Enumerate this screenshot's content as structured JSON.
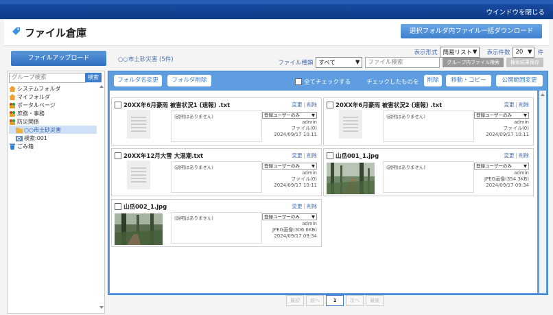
{
  "window": {
    "close_label": "ウインドウを閉じる"
  },
  "header": {
    "title": "ファイル倉庫",
    "download_label": "選択フォルダ内ファイル一括ダウンロード"
  },
  "upload_label": "ファイルアップロード",
  "current_folder": "○○市土砂災害 (5件)",
  "controls": {
    "display_format_label": "表示形式",
    "display_format_value": "簡易リスト",
    "count_label": "表示件数",
    "count_value": "20",
    "count_unit": "件",
    "file_type_label": "ファイル種類",
    "file_type_value": "すべて",
    "search_placeholder": "ファイル検索",
    "group_search_btn": "グループ内ファイル検索",
    "save_search_btn": "検索結果保存"
  },
  "sidebar": {
    "search_placeholder": "グループ検索",
    "search_btn": "検索",
    "items": [
      {
        "label": "システムフォルダ",
        "icon": "home-folder-icon"
      },
      {
        "label": "マイフォルダ",
        "icon": "home-folder-icon"
      },
      {
        "label": "ポータルページ",
        "icon": "group-icon"
      },
      {
        "label": "庶務・事務",
        "icon": "group-icon"
      },
      {
        "label": "防災関係",
        "icon": "group-icon"
      },
      {
        "label": "○○市土砂災害",
        "icon": "folder-icon"
      },
      {
        "label": "検索:001",
        "icon": "search-folder-icon"
      },
      {
        "label": "ごみ箱",
        "icon": "trash-icon"
      }
    ]
  },
  "toolbar": {
    "rename_folder": "フォルダ名変更",
    "delete_folder": "フォルダ削除",
    "check_all": "全てチェックする",
    "checked_label": "チェックしたものを",
    "delete": "削除",
    "move_copy": "移動・コピー",
    "change_scope": "公開範囲変更"
  },
  "card_links": {
    "edit": "変更",
    "delete": "削除"
  },
  "files": [
    {
      "name": "20XX年6月豪雨 被害状況1 (速報) .txt",
      "desc": "(説明はありません)",
      "scope": "登録ユーザーのみ",
      "owner": "admin",
      "type": "ファイル(0)",
      "date": "2024/09/17 10:11",
      "thumb": "document"
    },
    {
      "name": "20XX年6月豪雨 被害状況2 (速報) .txt",
      "desc": "(説明はありません)",
      "scope": "登録ユーザーのみ",
      "owner": "admin",
      "type": "ファイル(0)",
      "date": "2024/09/17 10:11",
      "thumb": "document"
    },
    {
      "name": "20XX年12月大雪 大混潮.txt",
      "desc": "(説明はありません)",
      "scope": "登録ユーザーのみ",
      "owner": "admin",
      "type": "ファイル(0)",
      "date": "2024/09/17 10:11",
      "thumb": "document"
    },
    {
      "name": "山岳001_1.jpg",
      "desc": "(説明はありません)",
      "scope": "登録ユーザーのみ",
      "owner": "admin",
      "type": "JPEG画像(354.3KB)",
      "date": "2024/09/17 09:34",
      "thumb": "forest"
    },
    {
      "name": "山岳002_1.jpg",
      "desc": "(説明はありません)",
      "scope": "登録ユーザーのみ",
      "owner": "admin",
      "type": "JPEG画像(306.6KB)",
      "date": "2024/09/17 09:34",
      "thumb": "forest"
    }
  ],
  "pager": {
    "first": "最初",
    "prev": "前へ",
    "current": "1",
    "next": "次へ",
    "last": "最後"
  },
  "colors": {
    "accent": "#3d7fcc",
    "topbar": "#1b4fa8",
    "main_bg": "#5e9ee0"
  }
}
